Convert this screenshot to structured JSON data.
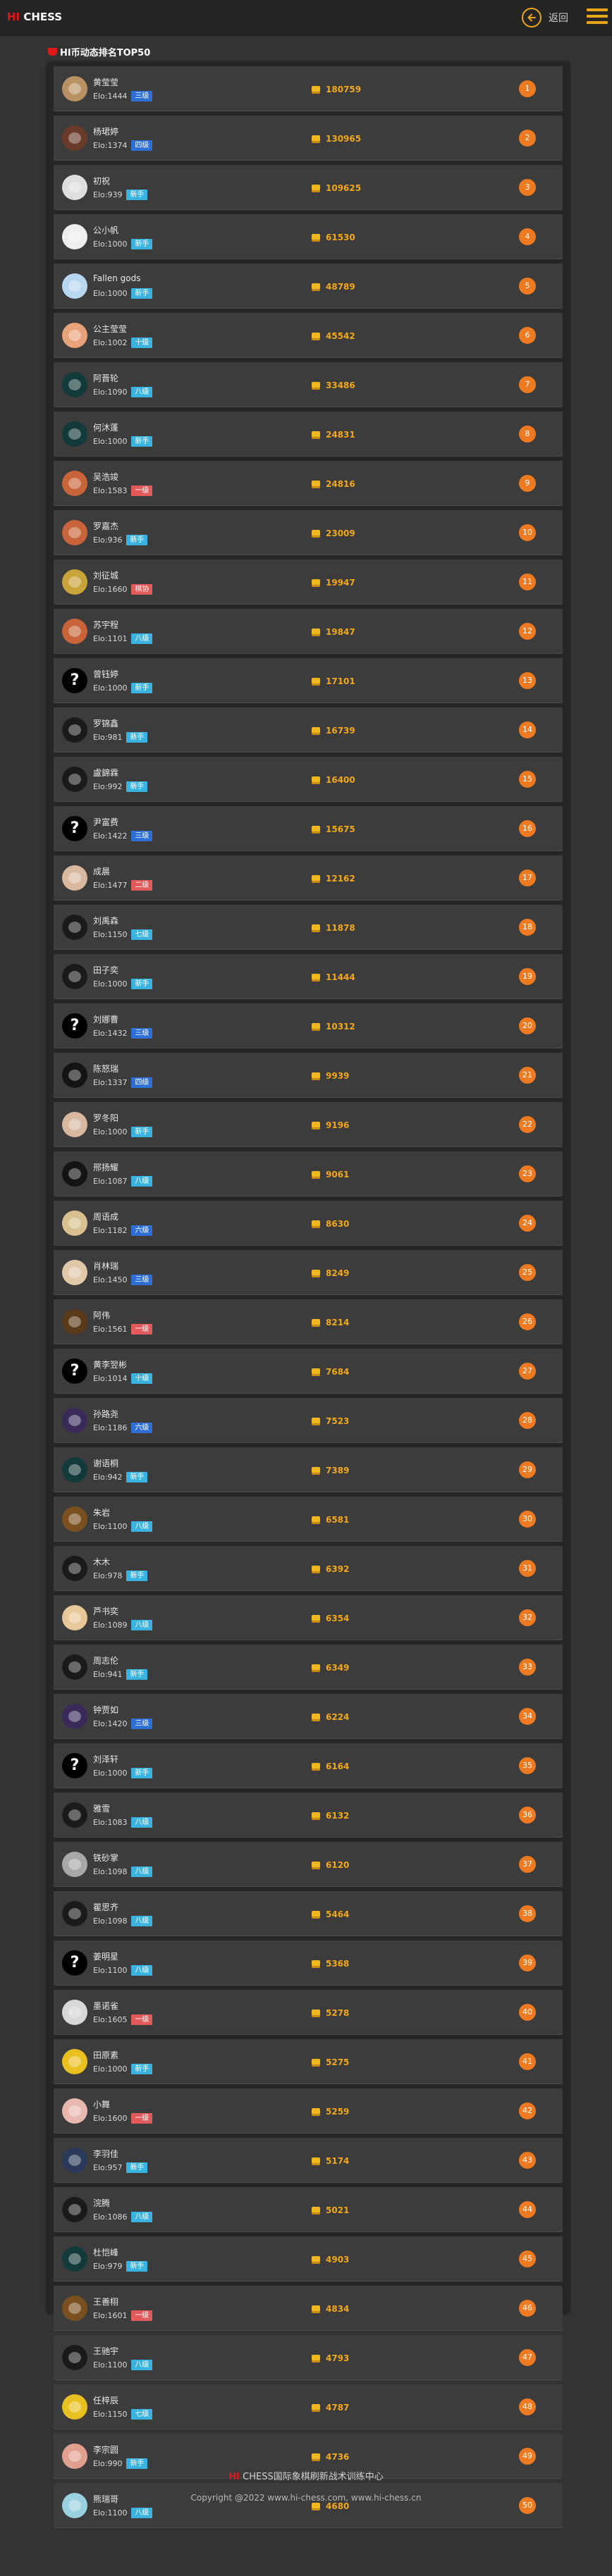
{
  "header": {
    "logo_hi": "HI",
    "logo_rest": " CHESS",
    "back_label": "返回"
  },
  "ranking": {
    "title": "HI币动态排名TOP50",
    "players": [
      {
        "rank": "1",
        "name": "黄莹莹",
        "elo": "Elo:1444",
        "grade": "三级",
        "grade_color": "#2c6fd6",
        "coins": "180759",
        "avatar": "#b99263"
      },
      {
        "rank": "2",
        "name": "杨珺婷",
        "elo": "Elo:1374",
        "grade": "四级",
        "grade_color": "#2c6fd6",
        "coins": "130965",
        "avatar": "#6a3a2a"
      },
      {
        "rank": "3",
        "name": "初祝",
        "elo": "Elo:939",
        "grade": "新手",
        "grade_color": "#3ab3e0",
        "coins": "109625",
        "avatar": "#dedede"
      },
      {
        "rank": "4",
        "name": "公小帆",
        "elo": "Elo:1000",
        "grade": "新手",
        "grade_color": "#3ab3e0",
        "coins": "61530",
        "avatar": "#eeeeee"
      },
      {
        "rank": "5",
        "name": "Fallen gods",
        "elo": "Elo:1000",
        "grade": "新手",
        "grade_color": "#3ab3e0",
        "coins": "48789",
        "avatar": "#b8d6ee"
      },
      {
        "rank": "6",
        "name": "公主莹莹",
        "elo": "Elo:1002",
        "grade": "十级",
        "grade_color": "#3ab3e0",
        "coins": "45542",
        "avatar": "#e8a27a"
      },
      {
        "rank": "7",
        "name": "阿晋轮",
        "elo": "Elo:1090",
        "grade": "八级",
        "grade_color": "#3ab3e0",
        "coins": "33486",
        "avatar": "#123a3a"
      },
      {
        "rank": "8",
        "name": "何沐蓬",
        "elo": "Elo:1000",
        "grade": "新手",
        "grade_color": "#3ab3e0",
        "coins": "24831",
        "avatar": "#123a3a"
      },
      {
        "rank": "9",
        "name": "吴浩竣",
        "elo": "Elo:1583",
        "grade": "一级",
        "grade_color": "#e25a5a",
        "coins": "24816",
        "avatar": "#c8643a"
      },
      {
        "rank": "10",
        "name": "罗嘉杰",
        "elo": "Elo:936",
        "grade": "新手",
        "grade_color": "#3ab3e0",
        "coins": "23009",
        "avatar": "#c8643a"
      },
      {
        "rank": "11",
        "name": "刘征城",
        "elo": "Elo:1660",
        "grade": "棋协",
        "grade_color": "#e25a5a",
        "coins": "19947",
        "avatar": "#c8a43a"
      },
      {
        "rank": "12",
        "name": "苏宇程",
        "elo": "Elo:1101",
        "grade": "八级",
        "grade_color": "#3ab3e0",
        "coins": "19847",
        "avatar": "#c8643a"
      },
      {
        "rank": "13",
        "name": "曾钰婷",
        "elo": "Elo:1000",
        "grade": "新手",
        "grade_color": "#3ab3e0",
        "coins": "17101",
        "avatar": "#000000",
        "qmark": "?"
      },
      {
        "rank": "14",
        "name": "罗锦鑫",
        "elo": "Elo:981",
        "grade": "新手",
        "grade_color": "#3ab3e0",
        "coins": "16739",
        "avatar": "#1a1a1a"
      },
      {
        "rank": "15",
        "name": "盧錦霖",
        "elo": "Elo:992",
        "grade": "新手",
        "grade_color": "#3ab3e0",
        "coins": "16400",
        "avatar": "#1a1a1a"
      },
      {
        "rank": "16",
        "name": "尹富费",
        "elo": "Elo:1422",
        "grade": "三级",
        "grade_color": "#2c6fd6",
        "coins": "15675",
        "avatar": "#000000",
        "qmark": "?"
      },
      {
        "rank": "17",
        "name": "成晨",
        "elo": "Elo:1477",
        "grade": "二级",
        "grade_color": "#e25a5a",
        "coins": "12162",
        "avatar": "#d9b8a0"
      },
      {
        "rank": "18",
        "name": "刘禹森",
        "elo": "Elo:1150",
        "grade": "七级",
        "grade_color": "#3ab3e0",
        "coins": "11878",
        "avatar": "#1a1a1a"
      },
      {
        "rank": "19",
        "name": "田子奕",
        "elo": "Elo:1000",
        "grade": "新手",
        "grade_color": "#3ab3e0",
        "coins": "11444",
        "avatar": "#1a1a1a"
      },
      {
        "rank": "20",
        "name": "刘娜曹",
        "elo": "Elo:1432",
        "grade": "三级",
        "grade_color": "#2c6fd6",
        "coins": "10312",
        "avatar": "#000000",
        "qmark": "?"
      },
      {
        "rank": "21",
        "name": "陈怒瑞",
        "elo": "Elo:1337",
        "grade": "四级",
        "grade_color": "#2c6fd6",
        "coins": "9939",
        "avatar": "#141414"
      },
      {
        "rank": "22",
        "name": "罗冬阳",
        "elo": "Elo:1000",
        "grade": "新手",
        "grade_color": "#3ab3e0",
        "coins": "9196",
        "avatar": "#d9b8a0"
      },
      {
        "rank": "23",
        "name": "邢扬耀",
        "elo": "Elo:1087",
        "grade": "八级",
        "grade_color": "#3ab3e0",
        "coins": "9061",
        "avatar": "#141414"
      },
      {
        "rank": "24",
        "name": "周语成",
        "elo": "Elo:1182",
        "grade": "六级",
        "grade_color": "#2c6fd6",
        "coins": "8630",
        "avatar": "#d8c090"
      },
      {
        "rank": "25",
        "name": "肖林瑞",
        "elo": "Elo:1450",
        "grade": "三级",
        "grade_color": "#2c6fd6",
        "coins": "8249",
        "avatar": "#e0c8a8"
      },
      {
        "rank": "26",
        "name": "阿伟",
        "elo": "Elo:1561",
        "grade": "一级",
        "grade_color": "#e25a5a",
        "coins": "8214",
        "avatar": "#5a3a1a"
      },
      {
        "rank": "27",
        "name": "黄李翌彬",
        "elo": "Elo:1014",
        "grade": "十级",
        "grade_color": "#3ab3e0",
        "coins": "7684",
        "avatar": "#000000",
        "qmark": "?"
      },
      {
        "rank": "28",
        "name": "孙路尧",
        "elo": "Elo:1186",
        "grade": "六级",
        "grade_color": "#2c6fd6",
        "coins": "7523",
        "avatar": "#3a2a5a"
      },
      {
        "rank": "29",
        "name": "谢语桐",
        "elo": "Elo:942",
        "grade": "新手",
        "grade_color": "#3ab3e0",
        "coins": "7389",
        "avatar": "#123a3a"
      },
      {
        "rank": "30",
        "name": "朱岩",
        "elo": "Elo:1100",
        "grade": "八级",
        "grade_color": "#3ab3e0",
        "coins": "6581",
        "avatar": "#7a5020"
      },
      {
        "rank": "31",
        "name": "木木",
        "elo": "Elo:978",
        "grade": "新手",
        "grade_color": "#3ab3e0",
        "coins": "6392",
        "avatar": "#1a1a1a"
      },
      {
        "rank": "32",
        "name": "芦书奕",
        "elo": "Elo:1089",
        "grade": "八级",
        "grade_color": "#3ab3e0",
        "coins": "6354",
        "avatar": "#e8c898"
      },
      {
        "rank": "33",
        "name": "周志伦",
        "elo": "Elo:941",
        "grade": "新手",
        "grade_color": "#3ab3e0",
        "coins": "6349",
        "avatar": "#1a1a1a"
      },
      {
        "rank": "34",
        "name": "钟贾如",
        "elo": "Elo:1420",
        "grade": "三级",
        "grade_color": "#2c6fd6",
        "coins": "6224",
        "avatar": "#3a2a5a"
      },
      {
        "rank": "35",
        "name": "刘泽轩",
        "elo": "Elo:1000",
        "grade": "新手",
        "grade_color": "#3ab3e0",
        "coins": "6164",
        "avatar": "#000000",
        "qmark": "?"
      },
      {
        "rank": "36",
        "name": "雅雪",
        "elo": "Elo:1083",
        "grade": "八级",
        "grade_color": "#3ab3e0",
        "coins": "6132",
        "avatar": "#1a1a1a"
      },
      {
        "rank": "37",
        "name": "铁砂掌",
        "elo": "Elo:1098",
        "grade": "八级",
        "grade_color": "#3ab3e0",
        "coins": "6120",
        "avatar": "#a8a8a8"
      },
      {
        "rank": "38",
        "name": "瞿思齐",
        "elo": "Elo:1098",
        "grade": "八级",
        "grade_color": "#3ab3e0",
        "coins": "5464",
        "avatar": "#1a1a1a"
      },
      {
        "rank": "39",
        "name": "姜明星",
        "elo": "Elo:1100",
        "grade": "八级",
        "grade_color": "#3ab3e0",
        "coins": "5368",
        "avatar": "#000000",
        "qmark": "?"
      },
      {
        "rank": "40",
        "name": "墨诺雀",
        "elo": "Elo:1605",
        "grade": "一级",
        "grade_color": "#e25a5a",
        "coins": "5278",
        "avatar": "#d8d8d8"
      },
      {
        "rank": "41",
        "name": "田原素",
        "elo": "Elo:1000",
        "grade": "新手",
        "grade_color": "#3ab3e0",
        "coins": "5275",
        "avatar": "#e8c020"
      },
      {
        "rank": "42",
        "name": "小舞",
        "elo": "Elo:1600",
        "grade": "一级",
        "grade_color": "#e25a5a",
        "coins": "5259",
        "avatar": "#e8b8b0"
      },
      {
        "rank": "43",
        "name": "李羽佳",
        "elo": "Elo:957",
        "grade": "新手",
        "grade_color": "#3ab3e0",
        "coins": "5174",
        "avatar": "#2a3a5a"
      },
      {
        "rank": "44",
        "name": "浣腾",
        "elo": "Elo:1086",
        "grade": "八级",
        "grade_color": "#3ab3e0",
        "coins": "5021",
        "avatar": "#1a1a1a"
      },
      {
        "rank": "45",
        "name": "杜恺峰",
        "elo": "Elo:979",
        "grade": "新手",
        "grade_color": "#3ab3e0",
        "coins": "4903",
        "avatar": "#123a3a"
      },
      {
        "rank": "46",
        "name": "王善栩",
        "elo": "Elo:1601",
        "grade": "一级",
        "grade_color": "#e25a5a",
        "coins": "4834",
        "avatar": "#7a5020"
      },
      {
        "rank": "47",
        "name": "王驰宇",
        "elo": "Elo:1100",
        "grade": "八级",
        "grade_color": "#3ab3e0",
        "coins": "4793",
        "avatar": "#1a1a1a"
      },
      {
        "rank": "48",
        "name": "任梓辰",
        "elo": "Elo:1150",
        "grade": "七级",
        "grade_color": "#3ab3e0",
        "coins": "4787",
        "avatar": "#e8c020"
      },
      {
        "rank": "49",
        "name": "李宗圆",
        "elo": "Elo:990",
        "grade": "新手",
        "grade_color": "#3ab3e0",
        "coins": "4736",
        "avatar": "#e0a090"
      },
      {
        "rank": "50",
        "name": "熊瑞哥",
        "elo": "Elo:1100",
        "grade": "八级",
        "grade_color": "#3ab3e0",
        "coins": "4680",
        "avatar": "#9ad0e0"
      }
    ]
  },
  "footer": {
    "title_hi": "HI",
    "title_rest": " CHESS国际象棋刷新战术训练中心",
    "copyright": "Copyright @2022 www.hi-chess.com, www.hi-chess.cn"
  }
}
